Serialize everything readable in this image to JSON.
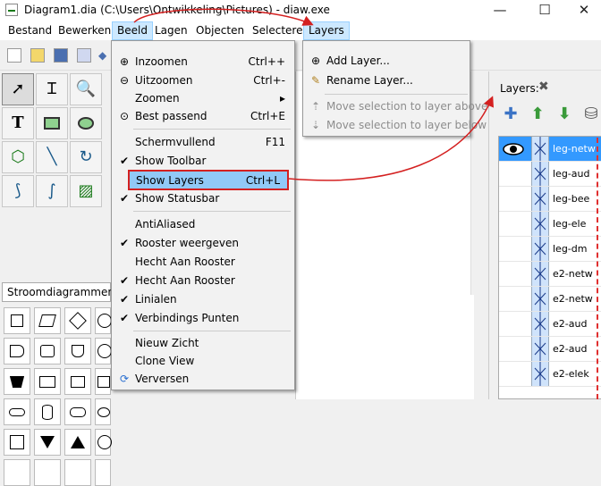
{
  "window": {
    "title": "Diagram1.dia (C:\\Users\\Ontwikkeling\\Pictures) - diaw.exe",
    "minimize": "—",
    "maximize": "☐",
    "close": "✕"
  },
  "menubar": {
    "items": [
      "Bestand",
      "Bewerken",
      "Beeld",
      "Lagen",
      "Objecten",
      "Selecteren",
      "Layers"
    ]
  },
  "toolbox": {
    "sheet": "Stroomdiagrammen",
    "tools": [
      "pointer-icon",
      "text-cursor-icon",
      "zoom-icon",
      "text-tool-icon",
      "box-icon",
      "ellipse-icon",
      "line-icon",
      "arc-icon",
      "zigzag-icon",
      "bezier-icon",
      "polygon-icon",
      "image-icon"
    ]
  },
  "beeld_menu": {
    "items": [
      {
        "label": "Inzoomen",
        "shortcut": "Ctrl++",
        "icon": "zoom-in-icon"
      },
      {
        "label": "Uitzoomen",
        "shortcut": "Ctrl+-",
        "icon": "zoom-out-icon"
      },
      {
        "label": "Zoomen",
        "shortcut": "▸",
        "icon": ""
      },
      {
        "label": "Best passend",
        "shortcut": "Ctrl+E",
        "icon": "zoom-fit-icon"
      },
      {
        "label": "Schermvullend",
        "shortcut": "F11",
        "icon": ""
      },
      {
        "label": "Show Toolbar",
        "shortcut": "",
        "icon": "checkmark-icon"
      },
      {
        "label": "Show Layers",
        "shortcut": "Ctrl+L",
        "icon": ""
      },
      {
        "label": "Show Statusbar",
        "shortcut": "",
        "icon": "checkmark-icon"
      },
      {
        "label": "AntiAliased",
        "shortcut": "",
        "icon": ""
      },
      {
        "label": "Rooster weergeven",
        "shortcut": "",
        "icon": "checkmark-icon"
      },
      {
        "label": "Hecht Aan Rooster",
        "shortcut": "",
        "icon": ""
      },
      {
        "label": "Hecht Aan Rooster",
        "shortcut": "",
        "icon": "checkmark-icon"
      },
      {
        "label": "Linialen",
        "shortcut": "",
        "icon": "checkmark-icon"
      },
      {
        "label": "Verbindings Punten",
        "shortcut": "",
        "icon": "checkmark-icon"
      },
      {
        "label": "Nieuw Zicht",
        "shortcut": "",
        "icon": ""
      },
      {
        "label": "Clone View",
        "shortcut": "",
        "icon": ""
      },
      {
        "label": "Verversen",
        "shortcut": "",
        "icon": "refresh-icon"
      }
    ]
  },
  "layers_menu": {
    "items": [
      {
        "label": "Add Layer...",
        "disabled": false
      },
      {
        "label": "Rename Layer...",
        "disabled": false
      },
      {
        "label": "Move selection to layer above",
        "disabled": true
      },
      {
        "label": "Move selection to layer below",
        "disabled": true
      }
    ]
  },
  "layers_panel": {
    "title": "Layers:",
    "layers": [
      "leg-netw",
      "leg-aud",
      "leg-bee",
      "leg-ele",
      "leg-dm",
      "e2-netw",
      "e2-netw",
      "e2-aud",
      "e2-aud",
      "e2-elek"
    ]
  },
  "colors": {
    "selection": "#3399ff",
    "menu_highlight": "#91c9f7",
    "annotation_red": "#d42020"
  }
}
